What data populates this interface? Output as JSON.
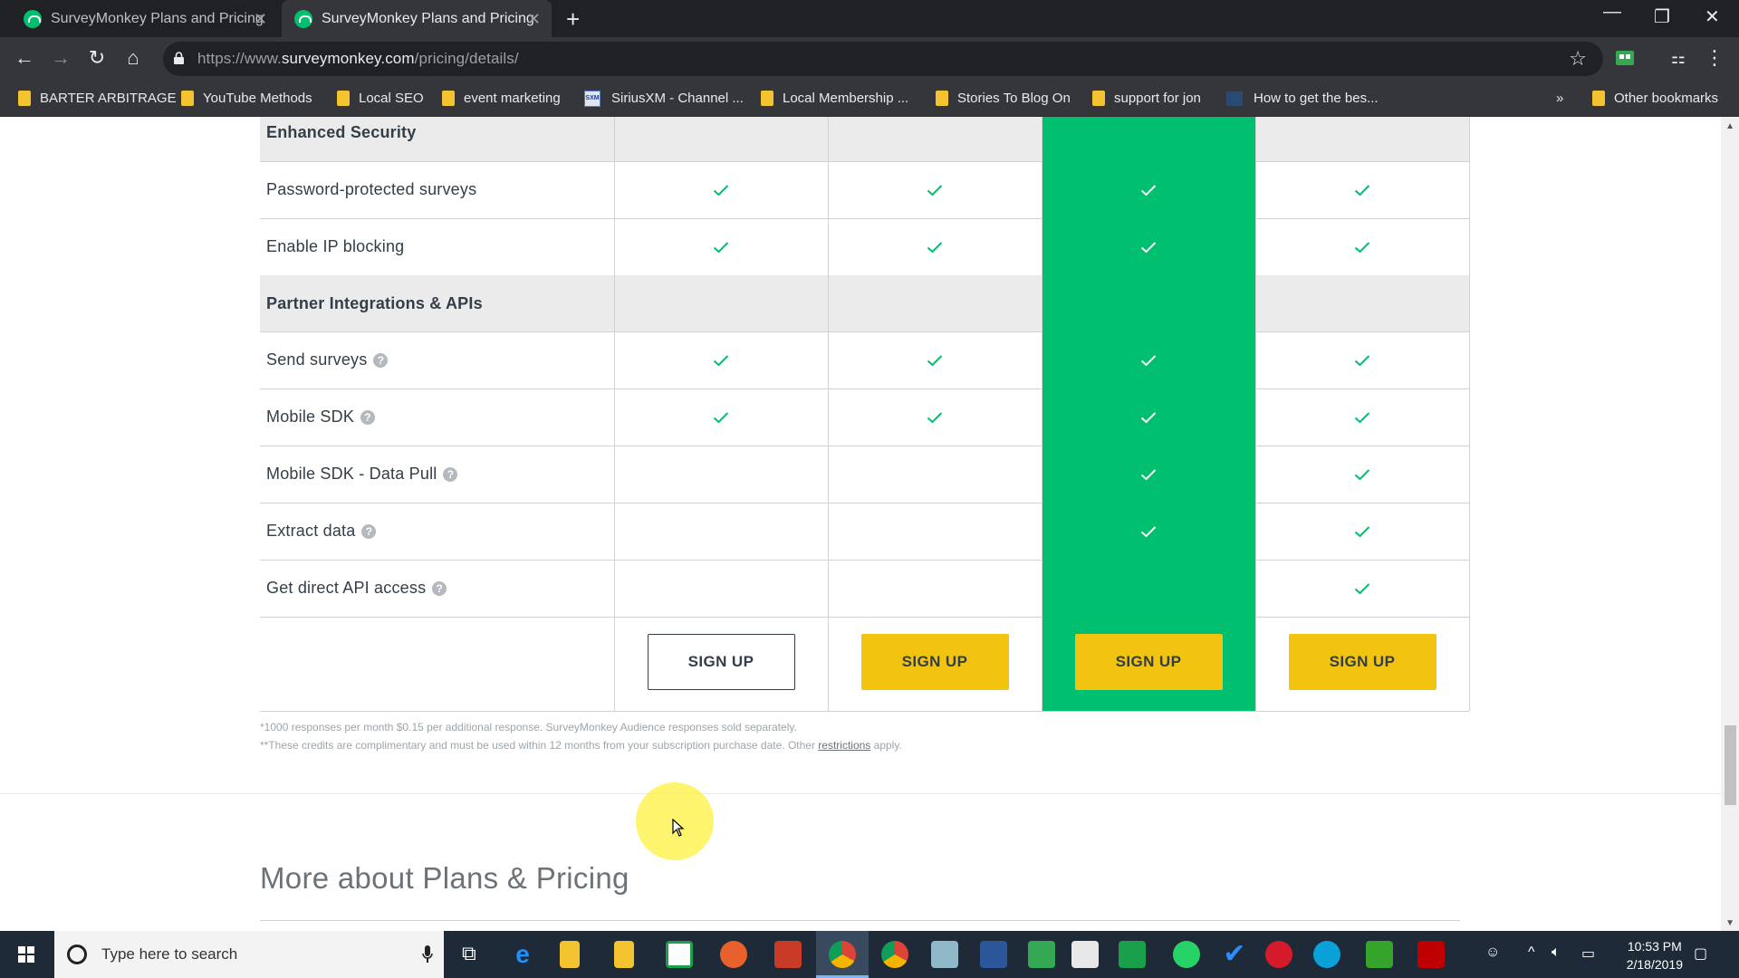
{
  "browser": {
    "tabs": [
      {
        "title": "SurveyMonkey Plans and Pricing",
        "active": false
      },
      {
        "title": "SurveyMonkey Plans and Pricing",
        "active": true
      }
    ],
    "url": {
      "host_prefix": "https://www.",
      "domain": "surveymonkey.com",
      "path": "/pricing/details/"
    },
    "bookmarks": [
      {
        "label": "BARTER ARBITRAGE",
        "icon": "folder-icon"
      },
      {
        "label": "YouTube Methods",
        "icon": "folder-icon"
      },
      {
        "label": "Local SEO",
        "icon": "folder-icon"
      },
      {
        "label": "event marketing",
        "icon": "folder-icon"
      },
      {
        "label": "SiriusXM - Channel ...",
        "icon": "siriusxm-icon"
      },
      {
        "label": "Local Membership ...",
        "icon": "folder-icon"
      },
      {
        "label": "Stories To Blog On",
        "icon": "folder-icon"
      },
      {
        "label": "support for jon",
        "icon": "folder-icon"
      },
      {
        "label": "How to get the bes...",
        "icon": "page-icon"
      }
    ],
    "bookmarks_overflow": "»",
    "other_bookmarks": "Other bookmarks"
  },
  "pricing": {
    "rows": [
      {
        "label": "Enhanced Security",
        "section": true,
        "help": false,
        "checks": [
          false,
          false,
          false,
          false
        ]
      },
      {
        "label": "Password-protected surveys",
        "section": false,
        "help": false,
        "checks": [
          true,
          true,
          true,
          true
        ]
      },
      {
        "label": "Enable IP blocking",
        "section": false,
        "help": false,
        "checks": [
          true,
          true,
          true,
          true
        ]
      },
      {
        "label": "Partner Integrations & APIs",
        "section": true,
        "help": false,
        "checks": [
          false,
          false,
          false,
          false
        ]
      },
      {
        "label": "Send surveys",
        "section": false,
        "help": true,
        "checks": [
          true,
          true,
          true,
          true
        ]
      },
      {
        "label": "Mobile SDK",
        "section": false,
        "help": true,
        "checks": [
          true,
          true,
          true,
          true
        ]
      },
      {
        "label": "Mobile SDK - Data Pull",
        "section": false,
        "help": true,
        "checks": [
          false,
          false,
          true,
          true
        ]
      },
      {
        "label": "Extract data",
        "section": false,
        "help": true,
        "checks": [
          false,
          false,
          true,
          true
        ]
      },
      {
        "label": "Get direct API access",
        "section": false,
        "help": true,
        "checks": [
          false,
          false,
          false,
          true
        ]
      }
    ],
    "signup_buttons": [
      "SIGN UP",
      "SIGN UP",
      "SIGN UP",
      "SIGN UP"
    ],
    "help_glyph": "?"
  },
  "footnotes": {
    "line1": "*1000 responses per month $0.15 per additional response. SurveyMonkey Audience responses sold separately.",
    "line2_pre": "**These credits are complimentary and must be used within 12 months from your subscription purchase date. Other ",
    "line2_link": "restrictions",
    "line2_post": " apply."
  },
  "more_section": {
    "heading": "More about Plans & Pricing"
  },
  "taskbar": {
    "search_placeholder": "Type here to search",
    "time": "10:53 PM",
    "date": "2/18/2019"
  },
  "colors": {
    "brand_green": "#00bf6f",
    "signup_yellow": "#f2c40f",
    "check_green": "#00bf6f"
  }
}
